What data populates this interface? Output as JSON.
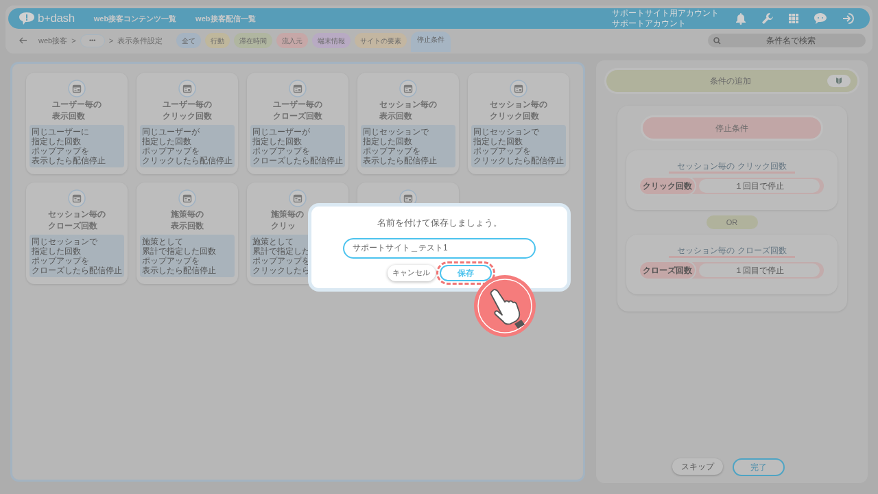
{
  "header": {
    "logo": "b+dash",
    "nav": [
      "web接客コンテンツ一覧",
      "web接客配信一覧"
    ],
    "account": [
      "サポートサイト用アカウント",
      "サポートアカウント"
    ]
  },
  "breadcrumb": [
    {
      "kind": "link",
      "label": "web接客"
    },
    {
      "kind": "sep",
      "label": ">"
    },
    {
      "kind": "more",
      "label": "•••"
    },
    {
      "kind": "sep",
      "label": ">"
    },
    {
      "kind": "text",
      "label": "表示条件設定"
    }
  ],
  "tabs": [
    {
      "label": "全て",
      "color": "#a5b3c1",
      "selected": false
    },
    {
      "label": "行動",
      "color": "#bfb79c",
      "selected": false
    },
    {
      "label": "滞在時間",
      "color": "#b0b6a0",
      "selected": false
    },
    {
      "label": "流入元",
      "color": "#c6a7a7",
      "selected": false
    },
    {
      "label": "端末情報",
      "color": "#b8aac3",
      "selected": false
    },
    {
      "label": "サイトの要素",
      "color": "#c3b6a1",
      "selected": false
    },
    {
      "label": "停止条件",
      "color": "#a6b5c3",
      "selected": true
    }
  ],
  "search": {
    "placeholder": "条件名で検索"
  },
  "cards": [
    {
      "title": [
        "ユーザー毎の",
        "表示回数"
      ],
      "description": [
        "同じユーザーに",
        "指定した回数",
        "ポップアップを",
        "表示したら配信停止"
      ]
    },
    {
      "title": [
        "ユーザー毎の",
        "クリック回数"
      ],
      "description": [
        "同じユーザーが",
        "指定した回数",
        "ポップアップを",
        "クリックしたら配信停止"
      ]
    },
    {
      "title": [
        "ユーザー毎の",
        "クローズ回数"
      ],
      "description": [
        "同じユーザーが",
        "指定した回数",
        "ポップアップを",
        "クローズしたら配信停止"
      ]
    },
    {
      "title": [
        "セッション毎の",
        "表示回数"
      ],
      "description": [
        "同じセッションで",
        "指定した回数",
        "ポップアップを",
        "表示したら配信停止"
      ]
    },
    {
      "title": [
        "セッション毎の",
        "クリック回数"
      ],
      "description": [
        "同じセッションで",
        "指定した回数",
        "ポップアップを",
        "クリックしたら配信停止"
      ]
    },
    {
      "title": [
        "セッション毎の",
        "クローズ回数"
      ],
      "description": [
        "同じセッションで",
        "指定した回数",
        "ポップアップを",
        "クローズしたら配信停止"
      ]
    },
    {
      "title": [
        "施策毎の",
        "表示回数"
      ],
      "description": [
        "施策として",
        "累計で指定した回数",
        "ポップアップを",
        "表示したら配信停止"
      ]
    },
    {
      "kind": "partial",
      "title": [
        "施策毎の",
        "クリッ"
      ],
      "description": [
        "施策として",
        "累計で指定した",
        "ポップアップを",
        "クリックしたら"
      ]
    },
    {
      "kind": "covered"
    }
  ],
  "conditions": {
    "add_label": "条件の追加",
    "group_title": "停止条件",
    "items": [
      {
        "title": "セッション毎の クリック回数",
        "label": "クリック回数",
        "value": "１回目で停止"
      },
      {
        "title": "セッション毎の クローズ回数",
        "label": "クローズ回数",
        "value": "１回目で停止"
      }
    ],
    "joiner": "OR"
  },
  "footer_buttons": [
    {
      "label": "スキップ",
      "primary": false
    },
    {
      "label": "完了",
      "primary": true
    }
  ],
  "modal": {
    "title": "名前を付けて保存しましょう。",
    "value": "サポートサイト＿テスト1",
    "cancel": "キャンセル",
    "save": "保存",
    "save_highlighted": true,
    "pointer": true
  }
}
